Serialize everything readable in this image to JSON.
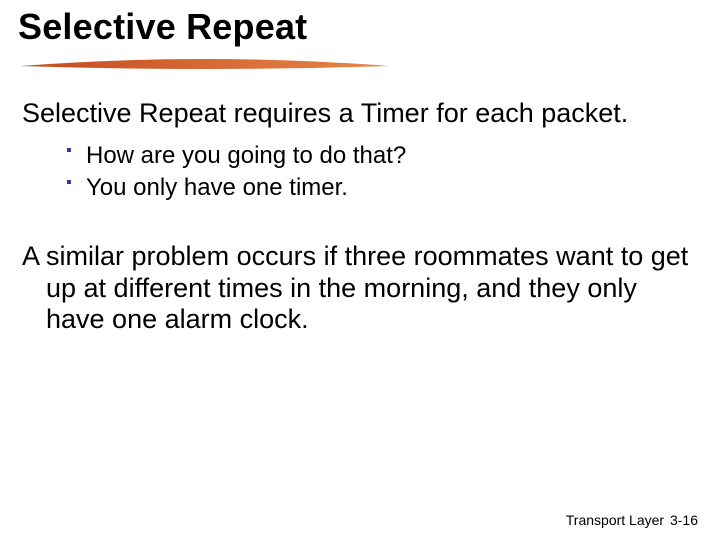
{
  "title": "Selective Repeat",
  "paragraphs": {
    "p1": "Selective Repeat requires a Timer for each packet.",
    "p2": "A similar problem occurs if three roommates want to get up at different times in the morning, and they only have one alarm clock."
  },
  "bullets": {
    "b1": "How are you going to do that?",
    "b2": "You only have one timer."
  },
  "footer": {
    "label": "Transport Layer",
    "page": "3-16"
  },
  "colors": {
    "underline_start": "#c54a1f",
    "underline_end": "#e6874a",
    "bullet": "#2a3a90"
  }
}
